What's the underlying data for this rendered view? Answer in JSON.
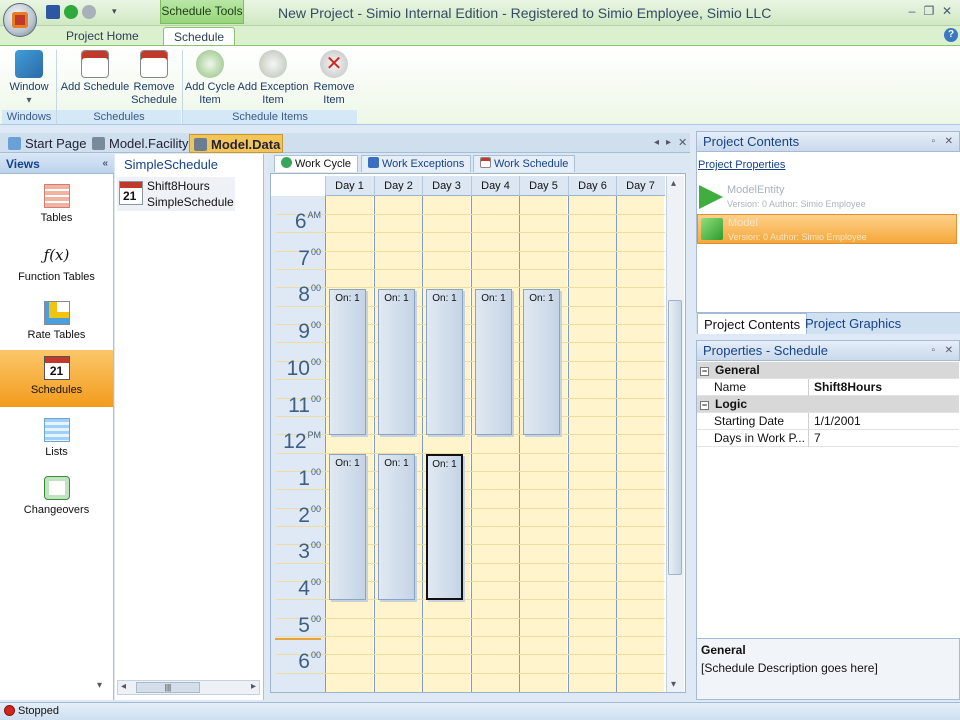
{
  "titlebar": {
    "context_label": "Schedule Tools",
    "title": "New Project - Simio Internal Edition - Registered to Simio Employee, Simio LLC",
    "min": "–",
    "max": "❐",
    "close": "✕"
  },
  "ribbon_tabs": {
    "project_home": "Project Home",
    "schedule": "Schedule"
  },
  "ribbon": {
    "window": {
      "label1": "Window",
      "label2": "▾"
    },
    "add_schedule": {
      "label1": "Add Schedule"
    },
    "remove_schedule": {
      "label1": "Remove",
      "label2": "Schedule"
    },
    "add_cycle": {
      "label1": "Add Cycle",
      "label2": "Item"
    },
    "add_exception": {
      "label1": "Add Exception",
      "label2": "Item"
    },
    "remove_item": {
      "label1": "Remove",
      "label2": "Item"
    },
    "groups": {
      "windows": "Windows",
      "schedules": "Schedules",
      "schedule_items": "Schedule Items"
    }
  },
  "doc_tabs": {
    "start": "Start Page",
    "facility": "Model.Facility",
    "data": "Model.Data"
  },
  "views": {
    "header": "Views",
    "items": [
      {
        "label": "Tables"
      },
      {
        "label": "Function Tables"
      },
      {
        "label": "Rate Tables"
      },
      {
        "label": "Schedules"
      },
      {
        "label": "Lists"
      },
      {
        "label": "Changeovers"
      }
    ]
  },
  "schedule_list": {
    "header": "SimpleSchedule",
    "item_name": "Shift8Hours",
    "item_sub": "SimpleSchedule",
    "cal_day": "21"
  },
  "work_tabs": {
    "cycle": "Work Cycle",
    "exceptions": "Work Exceptions",
    "schedule": "Work Schedule"
  },
  "days": [
    "Day 1",
    "Day 2",
    "Day 3",
    "Day 4",
    "Day 5",
    "Day 6",
    "Day 7"
  ],
  "hours": [
    {
      "h": "6",
      "s": "AM"
    },
    {
      "h": "7",
      "s": "00"
    },
    {
      "h": "8",
      "s": "00"
    },
    {
      "h": "9",
      "s": "00"
    },
    {
      "h": "10",
      "s": "00"
    },
    {
      "h": "11",
      "s": "00"
    },
    {
      "h": "12",
      "s": "PM"
    },
    {
      "h": "1",
      "s": "00"
    },
    {
      "h": "2",
      "s": "00"
    },
    {
      "h": "3",
      "s": "00"
    },
    {
      "h": "4",
      "s": "00"
    },
    {
      "h": "5",
      "s": "00"
    },
    {
      "h": "6",
      "s": "00"
    }
  ],
  "appointment_label": "On: 1",
  "appointments": {
    "morning_days": [
      1,
      2,
      3,
      4,
      5
    ],
    "afternoon_days": [
      1,
      2,
      3
    ],
    "selected": {
      "day": 3,
      "block": "afternoon"
    }
  },
  "project_contents": {
    "header": "Project Contents",
    "link": "Project Properties",
    "entities": [
      {
        "name": "ModelEntity",
        "version": "Version: 0 Author: Simio Employee"
      },
      {
        "name": "Model",
        "version": "Version: 0 Author: Simio Employee"
      }
    ],
    "tabs": {
      "contents": "Project Contents",
      "graphics": "Project Graphics"
    }
  },
  "properties": {
    "header": "Properties - Schedule",
    "rows": [
      {
        "category": "General"
      },
      {
        "name": "Name",
        "value": "Shift8Hours"
      },
      {
        "category": "Logic"
      },
      {
        "name": "Starting Date",
        "value": "1/1/2001"
      },
      {
        "name": "Days in Work P...",
        "value": "7"
      }
    ],
    "desc_title": "General",
    "desc_text": "[Schedule Description goes here]"
  },
  "status": {
    "text": "Stopped"
  },
  "colors": {
    "accent_green": "#96d67a",
    "selected_orange": "#f39b1c",
    "grid_yellow": "#fff4cc",
    "link_blue": "#15428b"
  }
}
